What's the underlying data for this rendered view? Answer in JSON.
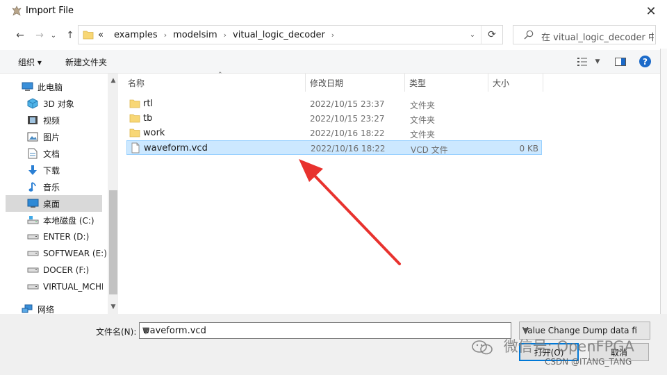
{
  "window": {
    "title": "Import File"
  },
  "nav": {
    "breadcrumb": [
      "«",
      "examples",
      "modelsim",
      "vitual_logic_decoder"
    ],
    "search_placeholder": "在 vitual_logic_decoder 中..."
  },
  "toolbar": {
    "organize": "组织 ▾",
    "new_folder": "新建文件夹"
  },
  "sidebar": {
    "items": [
      {
        "label": "此电脑",
        "icon": "pc-icon"
      },
      {
        "label": "3D 对象",
        "icon": "3d-objects-icon"
      },
      {
        "label": "视频",
        "icon": "video-icon"
      },
      {
        "label": "图片",
        "icon": "pictures-icon"
      },
      {
        "label": "文档",
        "icon": "documents-icon"
      },
      {
        "label": "下载",
        "icon": "download-icon"
      },
      {
        "label": "音乐",
        "icon": "music-icon"
      },
      {
        "label": "桌面",
        "icon": "desktop-icon",
        "selected": true
      },
      {
        "label": "本地磁盘 (C:)",
        "icon": "drive-c-icon"
      },
      {
        "label": "ENTER (D:)",
        "icon": "drive-icon"
      },
      {
        "label": "SOFTWEAR (E:)",
        "icon": "drive-icon"
      },
      {
        "label": "DOCER (F:)",
        "icon": "drive-icon"
      },
      {
        "label": "VIRTUAL_MCHI",
        "icon": "drive-icon"
      },
      {
        "label": "网络",
        "icon": "network-icon"
      }
    ]
  },
  "columns": {
    "name": "名称",
    "date": "修改日期",
    "type": "类型",
    "size": "大小"
  },
  "files": [
    {
      "name": "rtl",
      "date": "2022/10/15 23:37",
      "type": "文件夹",
      "size": "",
      "kind": "folder"
    },
    {
      "name": "tb",
      "date": "2022/10/15 23:27",
      "type": "文件夹",
      "size": "",
      "kind": "folder"
    },
    {
      "name": "work",
      "date": "2022/10/16 18:22",
      "type": "文件夹",
      "size": "",
      "kind": "folder"
    },
    {
      "name": "waveform.vcd",
      "date": "2022/10/16 18:22",
      "type": "VCD 文件",
      "size": "0 KB",
      "kind": "file",
      "selected": true
    }
  ],
  "bottom": {
    "filename_label": "文件名(N):",
    "filename_value": "waveform.vcd",
    "filetype_value": "Value Change Dump data fil",
    "open_label": "打开(O)",
    "cancel_label": "取消"
  },
  "watermarks": {
    "wechat": "微信号: OpenFPGA",
    "csdn": "CSDN @ITANG_TANG"
  },
  "colors": {
    "accent": "#0078d7",
    "selection": "#cce8ff",
    "folder": "#f8d775",
    "arrow": "#e8322e"
  }
}
